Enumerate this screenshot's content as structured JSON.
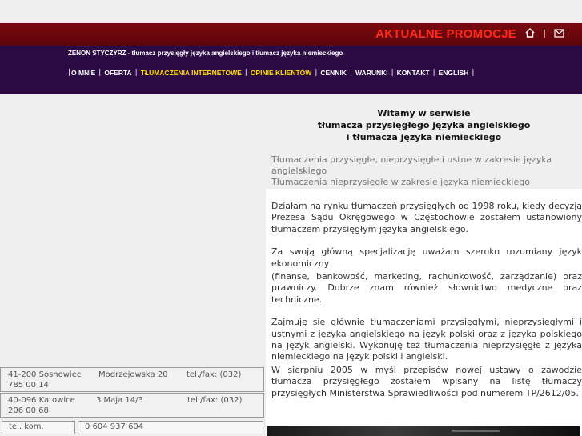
{
  "header": {
    "promo_label": "AKTUALNE PROMOCJE",
    "separator": "|",
    "icons": [
      "home-icon",
      "mail-icon"
    ]
  },
  "tagline": "ZENON STYCZYRZ - tłumacz przysięgły języka angielskiego i tłumacz języka niemieckiego",
  "nav": {
    "items": [
      {
        "label": "O MNIE",
        "highlight": false
      },
      {
        "label": "OFERTA",
        "highlight": false
      },
      {
        "label": "TŁUMACZENIA INTERNETOWE",
        "highlight": true
      },
      {
        "label": "OPINIE KLIENTÓW",
        "highlight": true
      },
      {
        "label": "CENNIK",
        "highlight": false
      },
      {
        "label": "WARUNKI",
        "highlight": false
      },
      {
        "label": "KONTAKT",
        "highlight": false
      },
      {
        "label": "ENGLISH",
        "highlight": false
      }
    ]
  },
  "welcome": {
    "line1": "Witamy w serwisie",
    "line2": "tłumacza przysięgłego języka angielskiego",
    "line3": "i tłumacza języka niemieckiego"
  },
  "intro": {
    "line1": "Tłumaczenia przysięgłe, nieprzysięgłe i ustne w zakresie języka angielskiego",
    "line2": "Tłumaczenia nieprzysięgłe w zakresie języka niemieckiego"
  },
  "body": {
    "p1": "Działam na rynku tłumaczeń przysięgłych od 1998 roku, kiedy decyzją Prezesa Sądu Okręgowego w Częstochowie zostałem ustanowiony tłumaczem przysięgłym języka angielskiego.",
    "p2a": "Za swoją główną specjalizację uważam szeroko rozumiany język ekonomiczny",
    "p2b": "(finanse, bankowość, marketing, rachunkowość, zarządzanie) oraz prawniczy. Dobrze znam również słownictwo medyczne oraz techniczne.",
    "p3": "Zajmuję się głównie tłumaczeniami przysięgłymi, nieprzysięgłymi i ustnymi z języka angielskiego na język polski oraz z języka polskiego na język angielski. Wykonuję też tłumaczenia nieprzysięgłe z języka niemieckiego na język polski i angielski.",
    "p4": "W sierpniu 2005 w myśl przepisów nowej ustawy o zawodzie tłumacza przysięgłego zostałem wpisany na listę tłumaczy przysięgłych Ministerstwa Sprawiedliwości pod numerem TP/2612/05."
  },
  "contacts": [
    {
      "city": "41-200 Sosnowiec",
      "street": "Modrzejowska 20",
      "tel_label": "tel./fax: (032)",
      "tel_cont": "785 00 14"
    },
    {
      "city": "40-096 Katowice",
      "street": "3 Maja 14/3",
      "tel_label": "tel./fax: (032)",
      "tel_cont": "206 00 68"
    }
  ],
  "mobile": {
    "label": "tel. kom.",
    "value": "0 604 937 604"
  }
}
